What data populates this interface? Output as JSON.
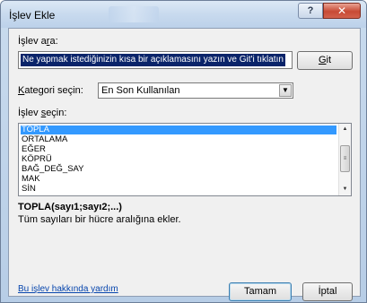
{
  "window": {
    "title": "İşlev Ekle",
    "help_glyph": "?",
    "close_glyph": "✕"
  },
  "search": {
    "label_pre": "İşlev a",
    "label_mnemonic": "r",
    "label_post": "a:",
    "value": "Ne yapmak istediğinizin kısa bir açıklamasını yazın ve Git'i tıklatın",
    "go_pre": "",
    "go_mnemonic": "G",
    "go_post": "it"
  },
  "category": {
    "label_mnemonic": "K",
    "label_post": "ategori seçin:",
    "selected": "En Son Kullanılan"
  },
  "function_list": {
    "label_pre": "İşlev ",
    "label_mnemonic": "s",
    "label_post": "eçin:",
    "items": [
      "TOPLA",
      "ORTALAMA",
      "EĞER",
      "KÖPRÜ",
      "BAĞ_DEĞ_SAY",
      "MAK",
      "SİN"
    ],
    "selected_index": 0
  },
  "details": {
    "syntax": "TOPLA(sayı1;sayı2;...)",
    "description": "Tüm sayıları bir hücre aralığına ekler."
  },
  "footer": {
    "help_link": "Bu işlev hakkında yardım",
    "ok_label": "Tamam",
    "cancel_label": "İptal"
  }
}
